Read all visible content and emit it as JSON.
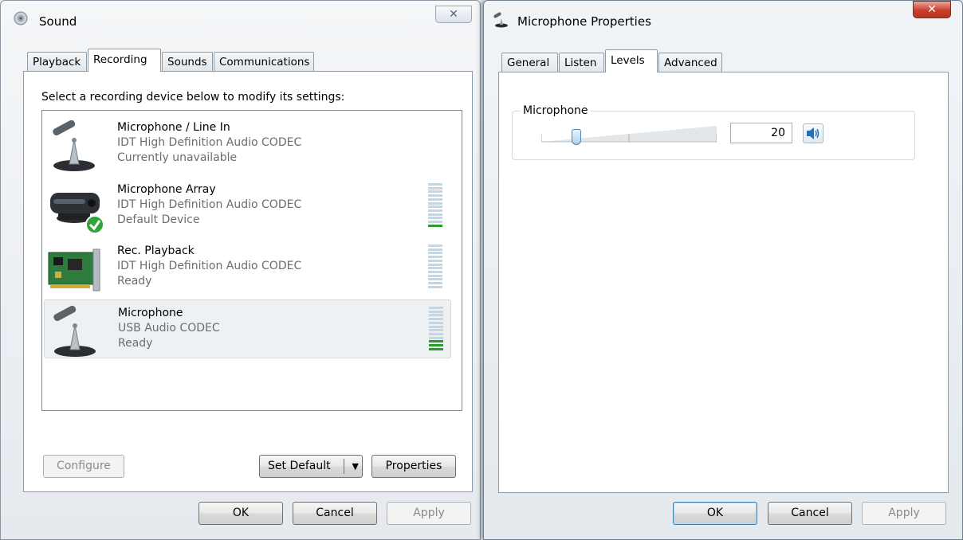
{
  "sound_window": {
    "title": "Sound",
    "tabs": [
      {
        "label": "Playback"
      },
      {
        "label": "Recording"
      },
      {
        "label": "Sounds"
      },
      {
        "label": "Communications"
      }
    ],
    "active_tab": "Recording",
    "instruction": "Select a recording device below to modify its settings:",
    "devices": [
      {
        "name": "Microphone / Line In",
        "codec": "IDT High Definition Audio CODEC",
        "status": "Currently unavailable",
        "icon": "microphone-icon",
        "level_bars": 0,
        "show_meter": false
      },
      {
        "name": "Microphone Array",
        "codec": "IDT High Definition Audio CODEC",
        "status": "Default Device",
        "icon": "webcam-microphone-icon",
        "default": true,
        "level_bars": 1,
        "show_meter": true
      },
      {
        "name": "Rec. Playback",
        "codec": "IDT High Definition Audio CODEC",
        "status": "Ready",
        "icon": "sound-card-icon",
        "level_bars": 0,
        "show_meter": true
      },
      {
        "name": "Microphone",
        "codec": "USB Audio CODEC",
        "status": "Ready",
        "icon": "microphone-icon",
        "selected": true,
        "level_bars": 3,
        "show_meter": true
      }
    ],
    "buttons": {
      "configure": "Configure",
      "set_default": "Set Default",
      "properties": "Properties",
      "ok": "OK",
      "cancel": "Cancel",
      "apply": "Apply"
    }
  },
  "mic_window": {
    "title": "Microphone Properties",
    "tabs": [
      {
        "label": "General"
      },
      {
        "label": "Listen"
      },
      {
        "label": "Levels"
      },
      {
        "label": "Advanced"
      }
    ],
    "active_tab": "Levels",
    "level_group": {
      "label": "Microphone",
      "value": "20",
      "slider_fraction": 0.2
    },
    "buttons": {
      "ok": "OK",
      "cancel": "Cancel",
      "apply": "Apply"
    }
  },
  "colors": {
    "meter_active": "#2a9d2a",
    "meter_inactive": "#c6d6e0",
    "accent": "#3c7fb1"
  }
}
